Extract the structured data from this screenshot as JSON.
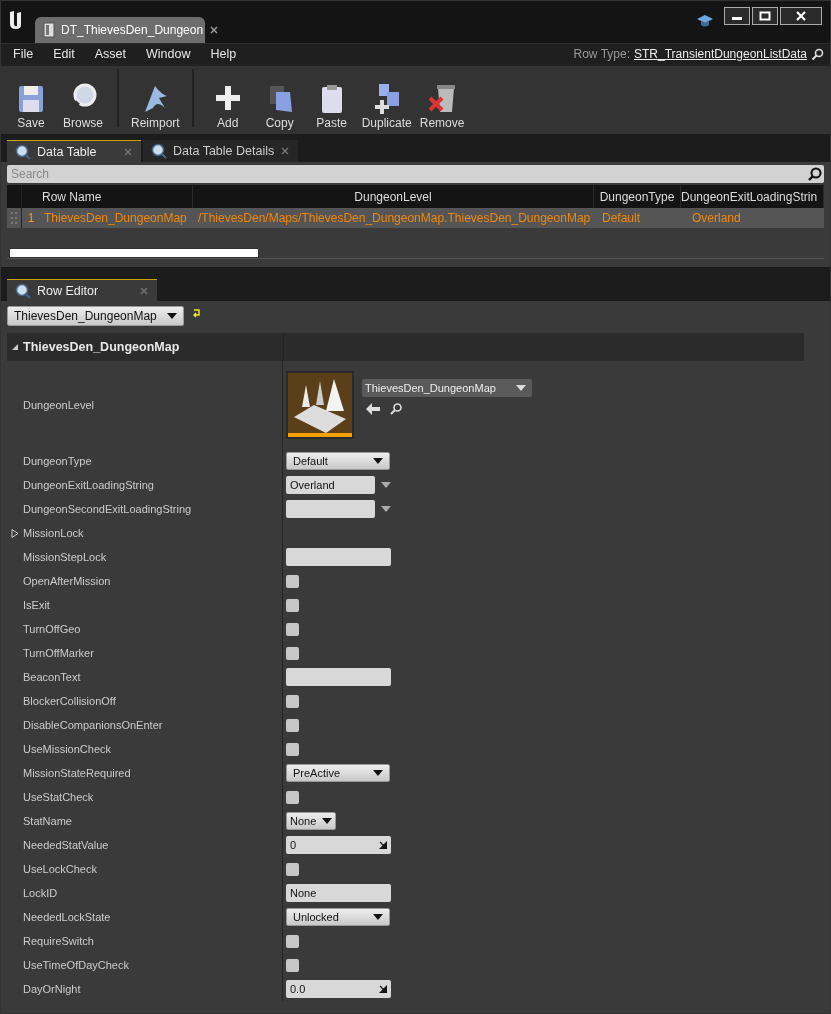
{
  "window": {
    "tab_title": "DT_ThievesDen_Dungeon"
  },
  "menu": [
    "File",
    "Edit",
    "Asset",
    "Window",
    "Help"
  ],
  "row_type": {
    "label": "Row Type:",
    "value": "STR_TransientDungeonListData"
  },
  "toolbar": [
    {
      "label": "Save",
      "kind": "save"
    },
    {
      "label": "Browse",
      "kind": "browse"
    },
    {
      "label": "Reimport",
      "kind": "reimport"
    },
    {
      "label": "Add",
      "kind": "add"
    },
    {
      "label": "Copy",
      "kind": "copy"
    },
    {
      "label": "Paste",
      "kind": "paste"
    },
    {
      "label": "Duplicate",
      "kind": "duplicate"
    },
    {
      "label": "Remove",
      "kind": "remove"
    }
  ],
  "tabs": [
    {
      "label": "Data Table",
      "selected": true
    },
    {
      "label": "Data Table Details",
      "selected": false
    }
  ],
  "search": {
    "placeholder": "Search"
  },
  "table": {
    "columns": [
      "Row Name",
      "DungeonLevel",
      "DungeonType",
      "DungeonExitLoadingStrin"
    ],
    "rows": [
      {
        "index": "1",
        "selected": true,
        "cells": [
          "ThievesDen_DungeonMap",
          "/ThievesDen/Maps/ThievesDen_DungeonMap.ThievesDen_DungeonMap",
          "Default",
          "Overland"
        ]
      }
    ]
  },
  "row_editor": {
    "tab": "Row Editor",
    "row_picker": "ThievesDen_DungeonMap",
    "group": "ThievesDen_DungeonMap",
    "properties": [
      {
        "name": "DungeonLevel",
        "kind": "asset",
        "value": "ThievesDen_DungeonMap"
      },
      {
        "name": "DungeonType",
        "kind": "combo",
        "value": "Default"
      },
      {
        "name": "DungeonExitLoadingString",
        "kind": "textcombo",
        "value": "Overland"
      },
      {
        "name": "DungeonSecondExitLoadingString",
        "kind": "textcombo"
      },
      {
        "name": "MissionLock",
        "kind": "expander",
        "expanded": false
      },
      {
        "name": "MissionStepLock",
        "kind": "text"
      },
      {
        "name": "OpenAfterMission",
        "kind": "checkbox",
        "checked": false
      },
      {
        "name": "IsExit",
        "kind": "checkbox",
        "checked": false
      },
      {
        "name": "TurnOffGeo",
        "kind": "checkbox",
        "checked": false
      },
      {
        "name": "TurnOffMarker",
        "kind": "checkbox",
        "checked": false
      },
      {
        "name": "BeaconText",
        "kind": "text"
      },
      {
        "name": "BlockerCollisionOff",
        "kind": "checkbox",
        "checked": false
      },
      {
        "name": "DisableCompanionsOnEnter",
        "kind": "checkbox",
        "checked": false
      },
      {
        "name": "UseMissionCheck",
        "kind": "checkbox",
        "checked": false
      },
      {
        "name": "MissionStateRequired",
        "kind": "combo",
        "value": "PreActive"
      },
      {
        "name": "UseStatCheck",
        "kind": "checkbox",
        "checked": false
      },
      {
        "name": "StatName",
        "kind": "smallcombo",
        "value": "None"
      },
      {
        "name": "NeededStatValue",
        "kind": "number",
        "value": "0"
      },
      {
        "name": "UseLockCheck",
        "kind": "checkbox",
        "checked": false
      },
      {
        "name": "LockID",
        "kind": "text",
        "value": "None"
      },
      {
        "name": "NeededLockState",
        "kind": "combo",
        "value": "Unlocked"
      },
      {
        "name": "RequireSwitch",
        "kind": "checkbox",
        "checked": false
      },
      {
        "name": "UseTimeOfDayCheck",
        "kind": "checkbox",
        "checked": false
      },
      {
        "name": "DayOrNight",
        "kind": "number",
        "value": "0.0"
      }
    ]
  }
}
